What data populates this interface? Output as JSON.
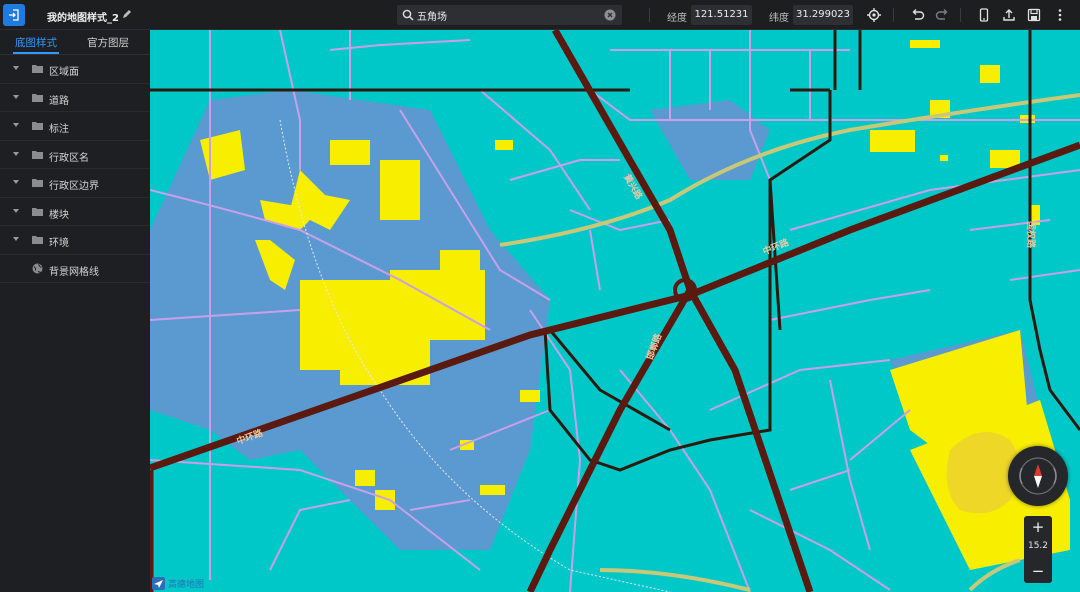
{
  "header": {
    "title": "我的地图样式_2",
    "search_value": "五角场",
    "longitude_label": "经度",
    "longitude_value": "121.51231",
    "latitude_label": "纬度",
    "latitude_value": "31.299023"
  },
  "sidebar": {
    "tabs": [
      {
        "label": "底图样式",
        "active": true
      },
      {
        "label": "官方图层",
        "active": false
      }
    ],
    "layers": [
      {
        "label": "区域面",
        "icon": "folder-icon"
      },
      {
        "label": "道路",
        "icon": "folder-icon"
      },
      {
        "label": "标注",
        "icon": "folder-icon"
      },
      {
        "label": "行政区名",
        "icon": "folder-icon"
      },
      {
        "label": "行政区边界",
        "icon": "folder-icon"
      },
      {
        "label": "楼块",
        "icon": "folder-icon"
      },
      {
        "label": "环境",
        "icon": "folder-icon"
      },
      {
        "label": "背景网格线",
        "icon": "globe-icon"
      }
    ]
  },
  "map": {
    "zoom_level": "15.2",
    "zoom_in_label": "+",
    "zoom_out_label": "−",
    "attribution": "高德地图",
    "road_labels": [
      "中环路",
      "中环路",
      "中环路",
      "黄兴路",
      "邯郸路",
      "国权路"
    ],
    "colors": {
      "background": "#01c8c8",
      "block": "#5a9ad0",
      "building": "#f8ee00",
      "highway": "#5a1a10",
      "minor_road": "#c9a0e8",
      "ring": "#2b1a0e"
    }
  },
  "colors": {
    "accent": "#2e9bff",
    "topbar": "#1d1e20",
    "sidebar": "#1e1f22"
  }
}
